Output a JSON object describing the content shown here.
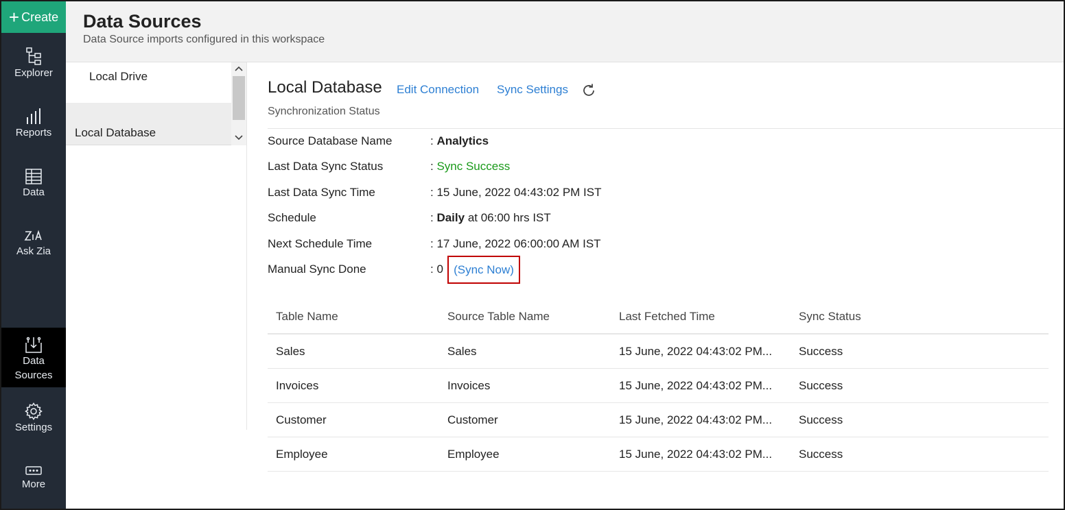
{
  "nav": {
    "create_label": "Create",
    "items": [
      {
        "label": "Explorer",
        "icon": "explorer-icon"
      },
      {
        "label": "Reports",
        "icon": "reports-icon"
      },
      {
        "label": "Data",
        "icon": "data-icon"
      },
      {
        "label": "Ask Zia",
        "icon": "zia-icon"
      },
      {
        "label_line1": "Data",
        "label_line2": "Sources",
        "icon": "data-sources-icon",
        "active": true
      },
      {
        "label": "Settings",
        "icon": "gear-icon"
      },
      {
        "label": "More",
        "icon": "more-icon"
      }
    ]
  },
  "header": {
    "title": "Data Sources",
    "subtitle": "Data Source imports configured in this workspace"
  },
  "sources": [
    {
      "label": "Local Drive"
    },
    {
      "label": "Local Database",
      "selected": true
    }
  ],
  "main": {
    "title": "Local Database",
    "edit_connection": "Edit Connection",
    "sync_settings": "Sync Settings",
    "sync_status_heading": "Synchronization Status",
    "info": {
      "source_db": {
        "key": "Source Database Name",
        "prefix": ": ",
        "value": "Analytics"
      },
      "last_status": {
        "key": "Last Data Sync Status",
        "prefix": ": ",
        "value": "Sync Success"
      },
      "last_time": {
        "key": "Last Data Sync Time",
        "value": ": 15 June, 2022 04:43:02 PM IST"
      },
      "schedule": {
        "key": "Schedule",
        "prefix": ": ",
        "value_bold": "Daily",
        "value_rest": " at 06:00 hrs IST"
      },
      "next_time": {
        "key": "Next Schedule Time",
        "value": ": 17 June, 2022 06:00:00 AM IST"
      },
      "manual": {
        "key": "Manual Sync Done",
        "value": ": 0",
        "sync_now": "(Sync Now)"
      }
    },
    "table": {
      "headers": [
        "Table Name",
        "Source Table Name",
        "Last Fetched Time",
        "Sync Status"
      ],
      "rows": [
        [
          "Sales",
          "Sales",
          "15 June, 2022 04:43:02 PM...",
          "Success"
        ],
        [
          "Invoices",
          "Invoices",
          "15 June, 2022 04:43:02 PM...",
          "Success"
        ],
        [
          "Customer",
          "Customer",
          "15 June, 2022 04:43:02 PM...",
          "Success"
        ],
        [
          "Employee",
          "Employee",
          "15 June, 2022 04:43:02 PM...",
          "Success"
        ]
      ]
    }
  },
  "colors": {
    "nav_bg": "#232b36",
    "create_bg": "#1fa67a",
    "link": "#2d7fd3",
    "success": "#1a9a1a",
    "highlight_border": "#c00000"
  }
}
